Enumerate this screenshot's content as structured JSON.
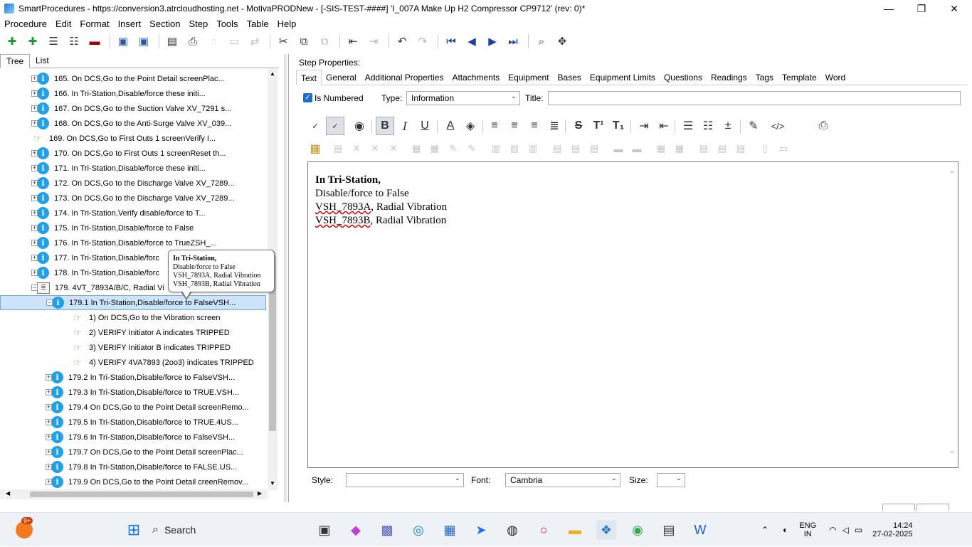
{
  "window": {
    "title": "SmartProcedures - https://conversion3.atrcloudhosting.net - MotivaPRODNew - [-SIS-TEST-####] 'I_007A Make Up H2 Compressor CP9712' (rev: 0)*",
    "minimize": "—",
    "restore": "❐",
    "close": "✕"
  },
  "menu": [
    "Procedure",
    "Edit",
    "Format",
    "Insert",
    "Section",
    "Step",
    "Tools",
    "Table",
    "Help"
  ],
  "left_tabs": {
    "tree": "Tree",
    "list": "List"
  },
  "tree_rows": [
    {
      "text": "165. On DCS,Go to the Point Detail screenPlac...",
      "icon": "info",
      "exp": "+"
    },
    {
      "text": "166. In Tri-Station,Disable/force these initi...",
      "icon": "info",
      "exp": "+"
    },
    {
      "text": "167. On DCS,Go to the Suction Valve XV_7291 s...",
      "icon": "info",
      "exp": "+"
    },
    {
      "text": "168. On DCS,Go to the Anti-Surge Valve XV_039...",
      "icon": "info",
      "exp": "+"
    },
    {
      "text": "169. On DCS,Go to First Outs 1 screenVerify I...",
      "icon": "hand",
      "exp": ""
    },
    {
      "text": "170. On DCS,Go to First Outs 1 screenReset th...",
      "icon": "info",
      "exp": "+"
    },
    {
      "text": "171. In Tri-Station,Disable/force these initi...",
      "icon": "info",
      "exp": "+"
    },
    {
      "text": "172. On DCS,Go to the Discharge Valve XV_7289...",
      "icon": "info",
      "exp": "+"
    },
    {
      "text": "173. On DCS,Go to the Discharge Valve XV_7289...",
      "icon": "info",
      "exp": "+"
    },
    {
      "text": "174. In Tri-Station,Verify disable/force to T...",
      "icon": "info",
      "exp": "+"
    },
    {
      "text": "175. In Tri-Station,Disable/force to False",
      "icon": "info",
      "exp": "+"
    },
    {
      "text": "176. In Tri-Station,Disable/force to TrueZSH_...",
      "icon": "info",
      "exp": "+"
    },
    {
      "text": "177. In Tri-Station,Disable/forc",
      "icon": "info",
      "exp": "+"
    },
    {
      "text": "178. In Tri-Station,Disable/forc",
      "icon": "info",
      "exp": "+"
    },
    {
      "text": "179. 4VT_7893A/B/C, Radial Vi",
      "icon": "doc",
      "exp": "−"
    },
    {
      "text": "179.1 In Tri-Station,Disable/force to FalseVSH...",
      "icon": "info",
      "exp": "−",
      "sel": true
    },
    {
      "text": "1) On DCS,Go to the Vibration screen",
      "icon": "hand",
      "exp": ""
    },
    {
      "text": "2) VERIFY Initiator A indicates TRIPPED",
      "icon": "hand",
      "exp": ""
    },
    {
      "text": "3) VERIFY Initiator B indicates TRIPPED",
      "icon": "hand",
      "exp": ""
    },
    {
      "text": "4) VERIFY 4VA7893 (2oo3) indicates TRIPPED",
      "icon": "hand",
      "exp": ""
    },
    {
      "text": "179.2 In Tri-Station,Disable/force to FalseVSH...",
      "icon": "info",
      "exp": "+"
    },
    {
      "text": "179.3 In Tri-Station,Disable/force to TRUE.VSH...",
      "icon": "info",
      "exp": "+"
    },
    {
      "text": "179.4 On DCS,Go to the Point Detail screenRemo...",
      "icon": "info",
      "exp": "+"
    },
    {
      "text": "179.5 In Tri-Station,Disable/force to TRUE.4US...",
      "icon": "info",
      "exp": "+"
    },
    {
      "text": "179.6 In Tri-Station,Disable/force to FalseVSH...",
      "icon": "info",
      "exp": "+"
    },
    {
      "text": "179.7 On DCS,Go to the Point Detail screenPlac...",
      "icon": "info",
      "exp": "+"
    },
    {
      "text": "179.8 In Tri-Station,Disable/force to FALSE.US...",
      "icon": "info",
      "exp": "+"
    },
    {
      "text": "179.9 On DCS,Go to the Point Detail creenRemov...",
      "icon": "info",
      "exp": "+"
    }
  ],
  "tooltip": {
    "line1": "In Tri-Station,",
    "line2": "Disable/force to False",
    "line3": "VSH_7893A, Radial Vibration",
    "line4": "VSH_7893B, Radial Vibration"
  },
  "step_props": {
    "label": "Step Properties:",
    "tabs": [
      "Text",
      "General",
      "Additional Properties",
      "Attachments",
      "Equipment",
      "Bases",
      "Equipment Limits",
      "Questions",
      "Readings",
      "Tags",
      "Template",
      "Word"
    ],
    "is_numbered": "Is Numbered",
    "type_label": "Type:",
    "type_value": "Information",
    "title_label": "Title:",
    "title_value": ""
  },
  "editor": {
    "line1": "In Tri-Station,",
    "line2": "Disable/force to False",
    "line3a": "VSH_7893A",
    "line3b": ", Radial Vibration",
    "line4a": "VSH_7893B",
    "line4b": ", Radial Vibration"
  },
  "bottom": {
    "style_label": "Style:",
    "style_value": "",
    "font_label": "Font:",
    "font_value": "Cambria",
    "size_label": "Size:",
    "size_value": ""
  },
  "taskbar": {
    "badge": "9+",
    "search": "Search",
    "lang1": "ENG",
    "lang2": "IN",
    "time": "14:24",
    "date": "27-02-2025"
  }
}
